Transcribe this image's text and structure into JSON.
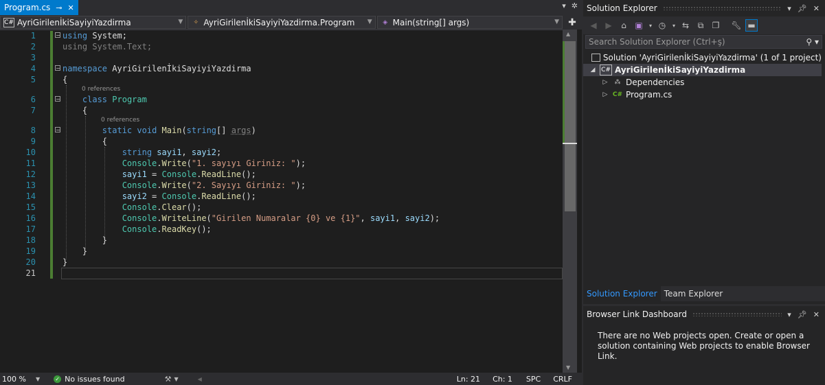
{
  "tab": {
    "label": "Program.cs",
    "pin": "⊸",
    "close": "✕"
  },
  "tabbar_right": {
    "dropdown": "▾",
    "settings": "✲"
  },
  "nav": {
    "project": {
      "badge": "C#",
      "label": "AyriGirilenİkiSayiyiYazdirma"
    },
    "class": {
      "label": "AyriGirilenİkiSayiyiYazdirma.Program"
    },
    "member": {
      "label": "Main(string[] args)"
    },
    "add_split": "✚"
  },
  "codelens": [
    "0 references",
    "0 references"
  ],
  "line_numbers": [
    "1",
    "2",
    "3",
    "4",
    "5",
    "6",
    "7",
    "8",
    "9",
    "10",
    "11",
    "12",
    "13",
    "14",
    "15",
    "16",
    "17",
    "18",
    "19",
    "20",
    "21"
  ],
  "status": {
    "zoom": "100 %",
    "issues": "No issues found",
    "ln": "Ln: 21",
    "ch": "Ch: 1",
    "spc": "SPC",
    "crlf": "CRLF"
  },
  "solution_explorer": {
    "title": "Solution Explorer",
    "search_placeholder": "Search Solution Explorer (Ctrl+ş)",
    "solution_label": "Solution 'AyriGirilenİkiSayiyiYazdirma' (1 of 1 project)",
    "project_badge": "C#",
    "project_label": "AyriGirilenİkiSayiyiYazdirma",
    "dependencies_label": "Dependencies",
    "file_badge": "C#",
    "file_label": "Program.cs",
    "tabs": [
      "Solution Explorer",
      "Team Explorer"
    ]
  },
  "browser_link": {
    "title": "Browser Link Dashboard",
    "message": "There are no Web projects open. Create or open a solution containing Web projects to enable Browser Link."
  },
  "colors": {
    "accent": "#007acc",
    "editor_bg": "#1e1e1e",
    "panel_bg": "#252526",
    "keyword": "#569cd6",
    "type": "#4ec9b0",
    "string": "#d69d85",
    "change_bar": "#4b7d32"
  }
}
